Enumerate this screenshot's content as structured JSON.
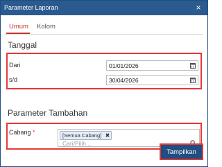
{
  "dialog": {
    "title": "Parameter Laporan",
    "close_label": "×"
  },
  "tabs": [
    {
      "label": "Umum",
      "active": true
    },
    {
      "label": "Kolom",
      "active": false
    }
  ],
  "section_date": {
    "title": "Tanggal",
    "from_label": "Dari",
    "from_value": "01/01/2026",
    "to_label": "s/d",
    "to_value": "30/04/2026"
  },
  "section_extra": {
    "title": "Parameter Tambahan",
    "branch_label": "Cabang",
    "required_mark": "*",
    "selected_chip": "[Semua Cabang]",
    "chip_remove": "✖",
    "placeholder": "Cari/Pilih..."
  },
  "actions": {
    "submit_label": "Tampilkan"
  },
  "colors": {
    "titlebar": "#2b5b8e",
    "accent_tab": "#c0392b",
    "highlight": "#e53935",
    "button": "#1f4e82"
  },
  "icons": {
    "calendar": "calendar-icon",
    "search": "search-icon"
  }
}
